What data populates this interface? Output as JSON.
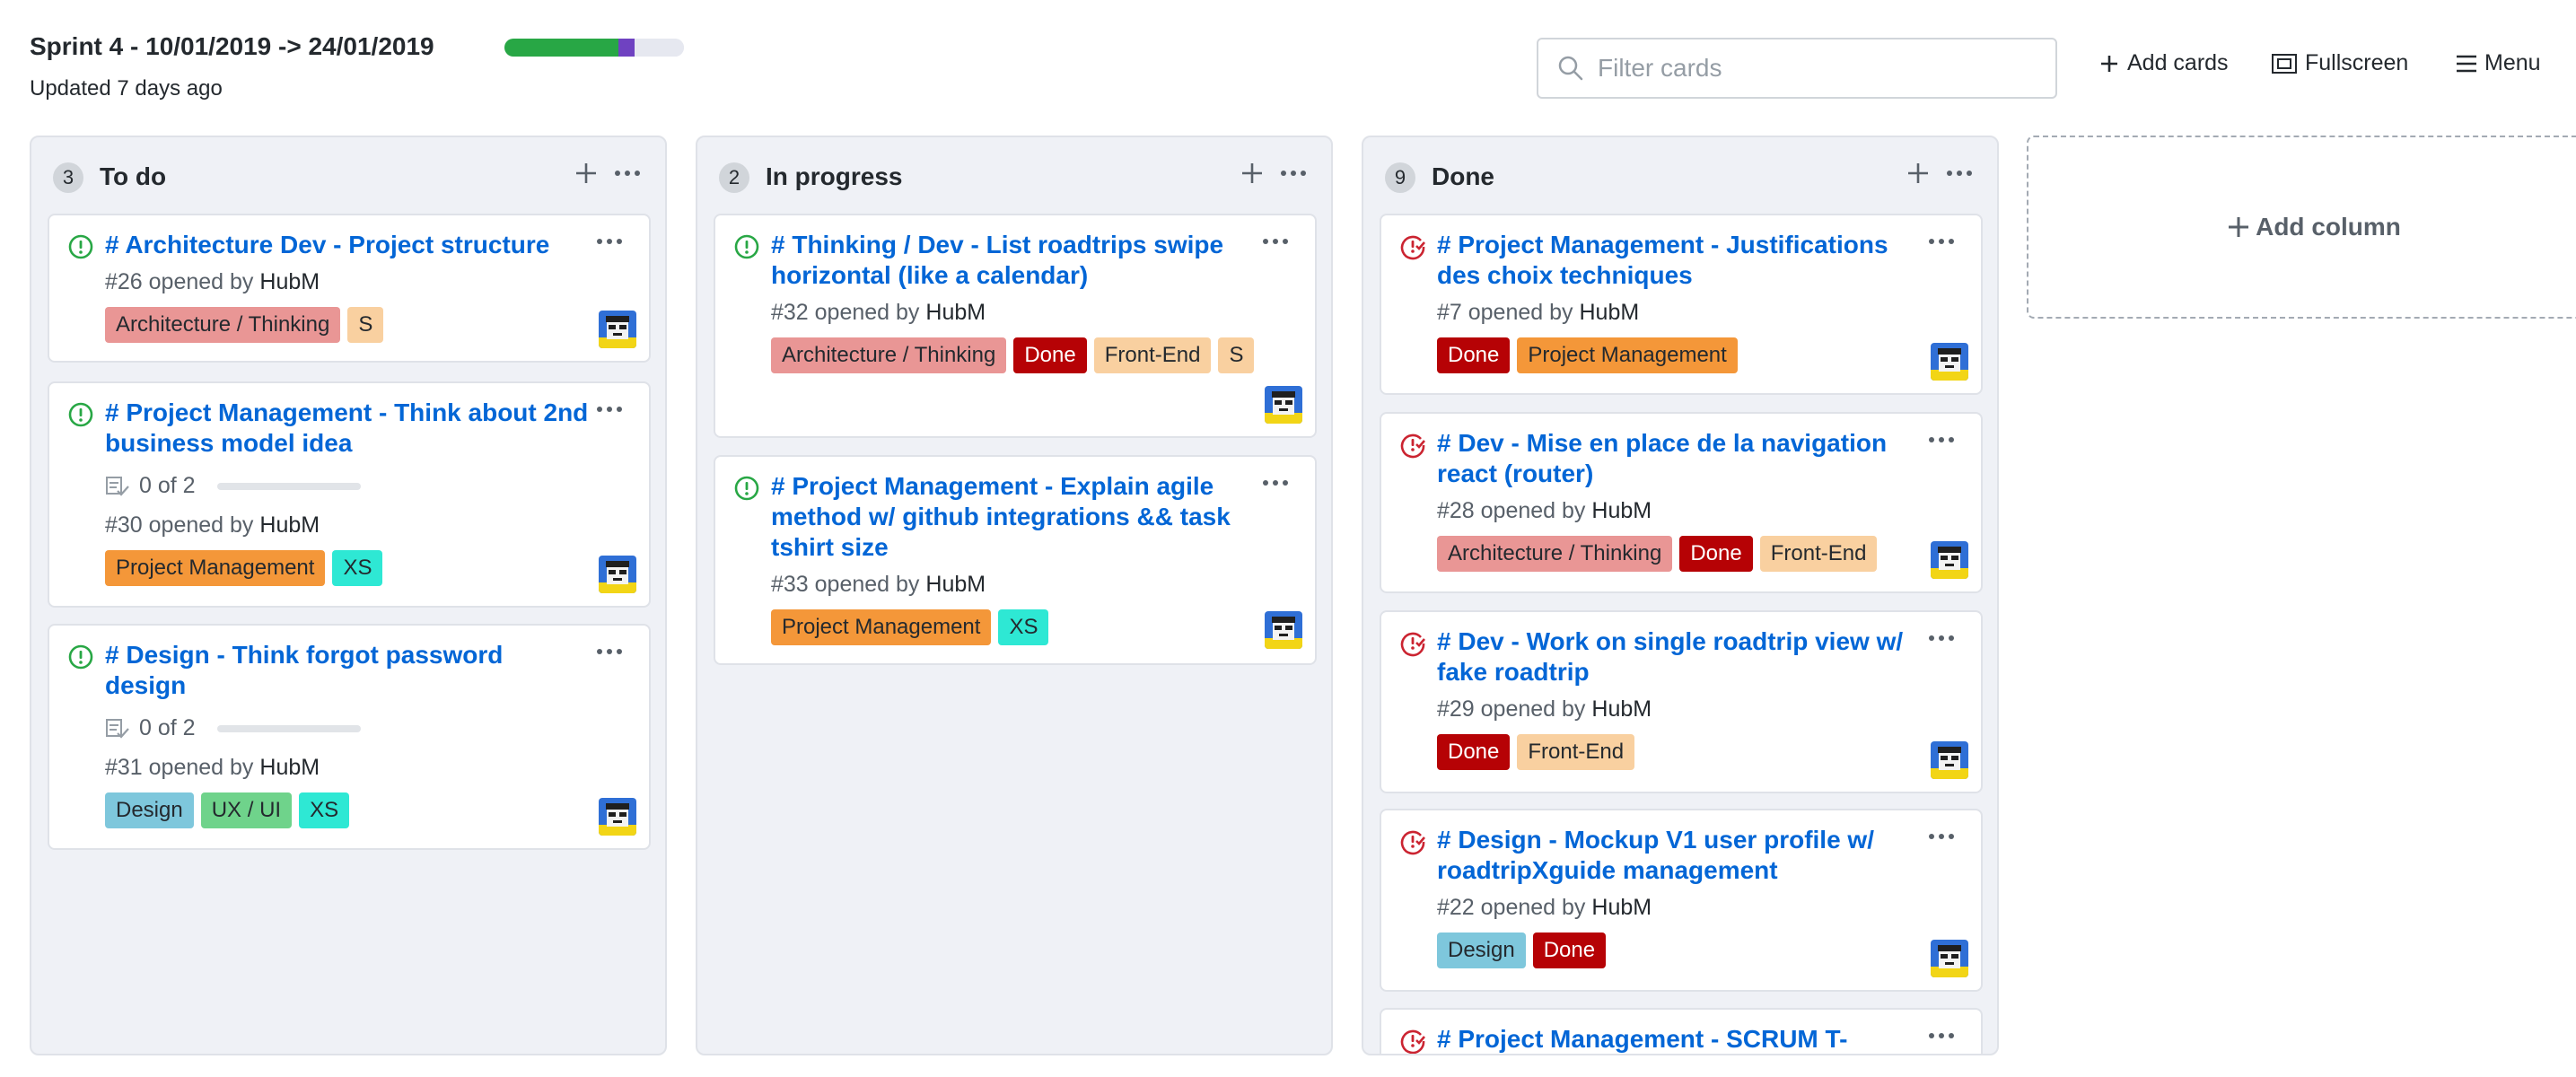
{
  "header": {
    "title": "Sprint 4 - 10/01/2019 -> 24/01/2019",
    "updated": "Updated 7 days ago",
    "progress": [
      {
        "fraction": 0.636,
        "color": "#28a745"
      },
      {
        "fraction": 0.091,
        "color": "#6f42c1"
      },
      {
        "fraction": 0.273,
        "color": "#e6e8f0"
      }
    ],
    "filter_placeholder": "Filter cards",
    "add_cards": "Add cards",
    "fullscreen": "Fullscreen",
    "menu": "Menu"
  },
  "colors": {
    "link": "#0366d6",
    "open_icon": "#28a745",
    "closed_icon": "#cb2431"
  },
  "columns": [
    {
      "count": "3",
      "name": "To do",
      "cards": [
        {
          "state": "open",
          "title": "# Architecture Dev - Project structure",
          "meta_prefix": "#26 opened by ",
          "author": "HubM",
          "labels": [
            {
              "text": "Architecture / Thinking",
              "bg": "#e99695",
              "fg": "#24292e"
            },
            {
              "text": "S",
              "bg": "#f9d0a0",
              "fg": "#24292e"
            }
          ]
        },
        {
          "state": "open",
          "title": "# Project Management - Think about 2nd business model idea",
          "checklist": "0 of 2",
          "meta_prefix": "#30 opened by ",
          "author": "HubM",
          "labels": [
            {
              "text": "Project Management",
              "bg": "#f49739",
              "fg": "#24292e"
            },
            {
              "text": "XS",
              "bg": "#2ee8d4",
              "fg": "#24292e"
            }
          ]
        },
        {
          "state": "open",
          "title": "# Design - Think forgot password design",
          "checklist": "0 of 2",
          "meta_prefix": "#31 opened by ",
          "author": "HubM",
          "labels": [
            {
              "text": "Design",
              "bg": "#7ec7dc",
              "fg": "#24292e"
            },
            {
              "text": "UX / UI",
              "bg": "#6fd38b",
              "fg": "#24292e"
            },
            {
              "text": "XS",
              "bg": "#2ee8d4",
              "fg": "#24292e"
            }
          ]
        }
      ]
    },
    {
      "count": "2",
      "name": "In progress",
      "cards": [
        {
          "state": "open",
          "title": "# Thinking / Dev - List roadtrips swipe horizontal (like a calendar)",
          "meta_prefix": "#32 opened by ",
          "author": "HubM",
          "labels": [
            {
              "text": "Architecture / Thinking",
              "bg": "#e99695",
              "fg": "#24292e"
            },
            {
              "text": "Done",
              "bg": "#b60205",
              "fg": "#ffffff"
            },
            {
              "text": "Front-End",
              "bg": "#f9d0a0",
              "fg": "#24292e"
            },
            {
              "text": "S",
              "bg": "#f9d0a0",
              "fg": "#24292e"
            }
          ]
        },
        {
          "state": "open",
          "title": "# Project Management - Explain agile method w/ github integrations && task tshirt size",
          "meta_prefix": "#33 opened by ",
          "author": "HubM",
          "labels": [
            {
              "text": "Project Management",
              "bg": "#f49739",
              "fg": "#24292e"
            },
            {
              "text": "XS",
              "bg": "#2ee8d4",
              "fg": "#24292e"
            }
          ]
        }
      ]
    },
    {
      "count": "9",
      "name": "Done",
      "cards": [
        {
          "state": "closed",
          "title": "# Project Management - Justifications des choix techniques",
          "meta_prefix": "#7 opened by ",
          "author": "HubM",
          "labels": [
            {
              "text": "Done",
              "bg": "#b60205",
              "fg": "#ffffff"
            },
            {
              "text": "Project Management",
              "bg": "#f49739",
              "fg": "#24292e"
            }
          ]
        },
        {
          "state": "closed",
          "title": "# Dev - Mise en place de la navigation react (router)",
          "meta_prefix": "#28 opened by ",
          "author": "HubM",
          "labels": [
            {
              "text": "Architecture / Thinking",
              "bg": "#e99695",
              "fg": "#24292e"
            },
            {
              "text": "Done",
              "bg": "#b60205",
              "fg": "#ffffff"
            },
            {
              "text": "Front-End",
              "bg": "#f9d0a0",
              "fg": "#24292e"
            }
          ]
        },
        {
          "state": "closed",
          "title": "# Dev - Work on single roadtrip view w/ fake roadtrip",
          "meta_prefix": "#29 opened by ",
          "author": "HubM",
          "labels": [
            {
              "text": "Done",
              "bg": "#b60205",
              "fg": "#ffffff"
            },
            {
              "text": "Front-End",
              "bg": "#f9d0a0",
              "fg": "#24292e"
            }
          ]
        },
        {
          "state": "closed",
          "title": "# Design - Mockup V1 user profile w/ roadtripXguide management",
          "meta_prefix": "#22 opened by ",
          "author": "HubM",
          "labels": [
            {
              "text": "Design",
              "bg": "#7ec7dc",
              "fg": "#24292e"
            },
            {
              "text": "Done",
              "bg": "#b60205",
              "fg": "#ffffff"
            }
          ]
        },
        {
          "state": "closed",
          "title": "# Project Management - SCRUM T-"
        }
      ]
    }
  ],
  "add_column": "Add column"
}
